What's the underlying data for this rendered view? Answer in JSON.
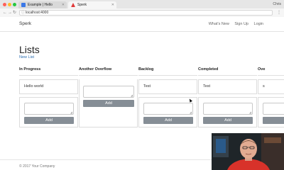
{
  "browser": {
    "tabs": [
      {
        "label": "Example | Hello",
        "icon": "document-icon",
        "active": false
      },
      {
        "label": "Sperk",
        "icon": "sperk-logo-icon",
        "active": true
      }
    ],
    "profile": "Chris",
    "url": "localhost:4000",
    "colors": {
      "close": "#ff5f57",
      "minimize": "#febc2e",
      "maximize": "#28c840"
    }
  },
  "navbar": {
    "brand": "Sperk",
    "links": [
      "What's New",
      "Sign Up",
      "Login"
    ]
  },
  "page": {
    "title": "Lists",
    "new_list": "New List"
  },
  "lists": [
    {
      "title": "In Progress",
      "cards": [
        "Hello world"
      ],
      "add_label": "Add"
    },
    {
      "title": "Another Overflow",
      "cards": [],
      "add_label": "Add"
    },
    {
      "title": "Backlog",
      "cards": [
        "Test"
      ],
      "add_label": "Add"
    },
    {
      "title": "Completed",
      "cards": [
        "Test"
      ],
      "add_label": "Add"
    },
    {
      "title": "Ove",
      "cards": [
        "s"
      ],
      "add_label": ""
    }
  ],
  "footer": {
    "text": "© 2017 Your Company"
  },
  "colors": {
    "button": "#868e96",
    "link": "#2a6db0",
    "webcam_shirt": "#d8322a"
  }
}
